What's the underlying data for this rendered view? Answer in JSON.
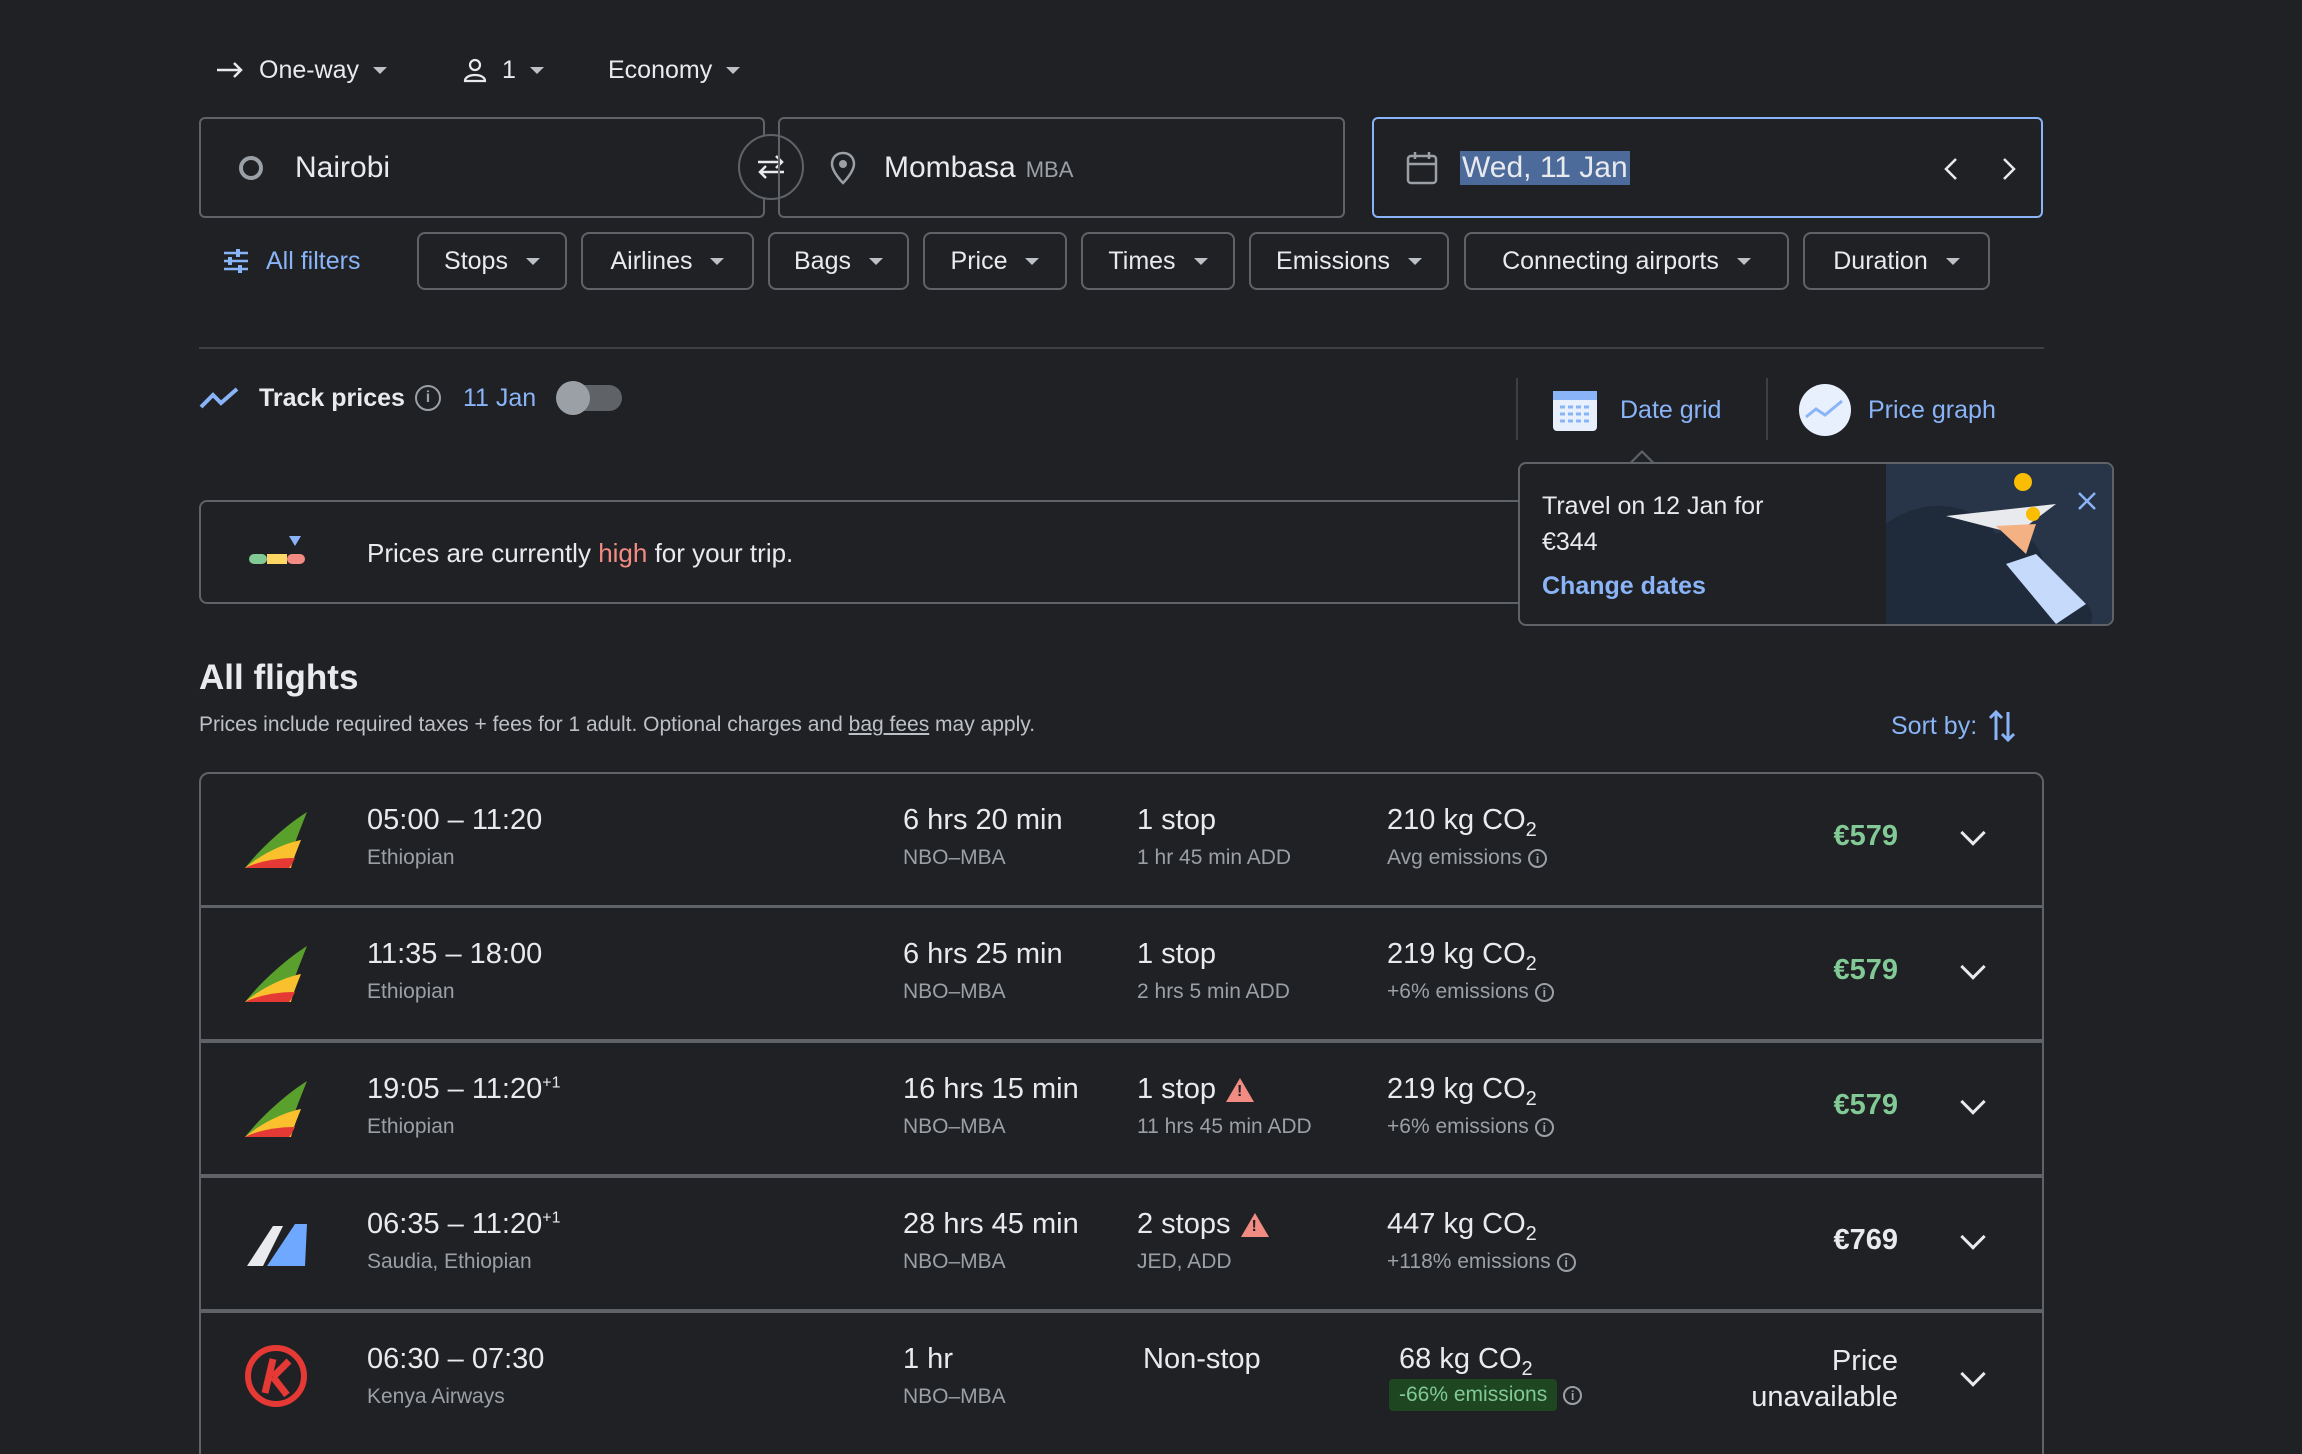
{
  "search": {
    "trip_type": "One-way",
    "passengers": "1",
    "cabin": "Economy",
    "origin": "Nairobi",
    "destination": "Mombasa",
    "destination_code": "MBA",
    "date": "Wed, 11 Jan"
  },
  "filters": {
    "all_filters": "All filters",
    "chips": [
      "Stops",
      "Airlines",
      "Bags",
      "Price",
      "Times",
      "Emissions",
      "Connecting airports",
      "Duration"
    ]
  },
  "track": {
    "label": "Track prices",
    "date": "11 Jan",
    "enabled": false
  },
  "views": {
    "date_grid": "Date grid",
    "price_graph": "Price graph"
  },
  "insight": {
    "prefix": "Prices are currently ",
    "level": "high",
    "suffix": " for your trip."
  },
  "tooltip": {
    "line1": "Travel on 12 Jan for",
    "line2": "€344",
    "action": "Change dates"
  },
  "results": {
    "title": "All flights",
    "note_prefix": "Prices include required taxes + fees for 1 adult. Optional charges and ",
    "note_link": "bag fees",
    "note_suffix": " may apply.",
    "sort_label": "Sort by:"
  },
  "flights": [
    {
      "time": "05:00 – 11:20",
      "day_offset": "",
      "airline": "Ethiopian",
      "duration": "6 hrs 20 min",
      "route": "NBO–MBA",
      "stops": "1 stop",
      "stop_detail": "1 hr 45 min ADD",
      "co2": "210 kg CO",
      "emissions": "Avg emissions",
      "price": "€579"
    },
    {
      "time": "11:35 – 18:00",
      "day_offset": "",
      "airline": "Ethiopian",
      "duration": "6 hrs 25 min",
      "route": "NBO–MBA",
      "stops": "1 stop",
      "stop_detail": "2 hrs 5 min ADD",
      "co2": "219 kg CO",
      "emissions": "+6% emissions",
      "price": "€579"
    },
    {
      "time": "19:05 – 11:20",
      "day_offset": "+1",
      "airline": "Ethiopian",
      "duration": "16 hrs 15 min",
      "route": "NBO–MBA",
      "stops": "1 stop",
      "stop_detail": "11 hrs 45 min ADD",
      "co2": "219 kg CO",
      "emissions": "+6% emissions",
      "price": "€579"
    },
    {
      "time": "06:35 – 11:20",
      "day_offset": "+1",
      "airline": "Saudia, Ethiopian",
      "duration": "28 hrs 45 min",
      "route": "NBO–MBA",
      "stops": "2 stops",
      "stop_detail": "JED, ADD",
      "co2": "447 kg CO",
      "emissions": "+118% emissions",
      "price": "€769"
    },
    {
      "time": "06:30 – 07:30",
      "day_offset": "",
      "airline": "Kenya Airways",
      "duration": "1 hr",
      "route": "NBO–MBA",
      "stops": "Non-stop",
      "stop_detail": "",
      "co2": "68 kg CO",
      "emissions": "-66% emissions",
      "price_line1": "Price",
      "price_line2": "unavailable"
    }
  ],
  "colors": {
    "accent": "#8ab4f8",
    "price_good": "#81c995",
    "high": "#f28b82",
    "border": "#5f6368",
    "background": "#202124"
  }
}
